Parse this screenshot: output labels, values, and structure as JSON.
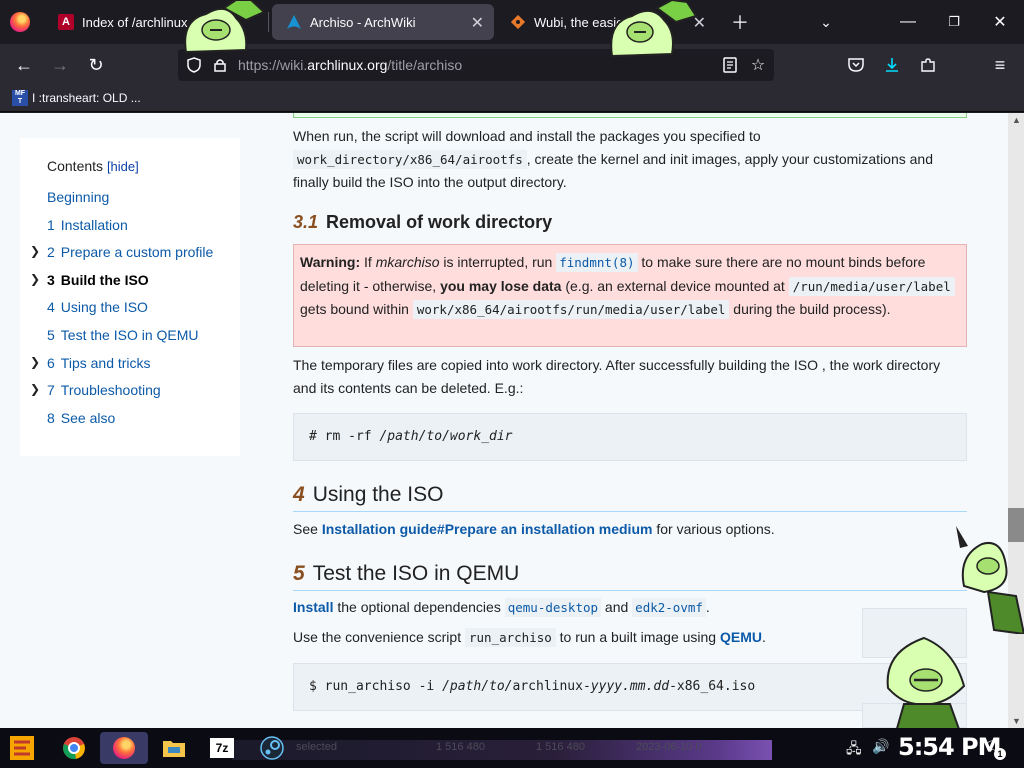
{
  "browser": {
    "tabs": [
      {
        "title": "Index of /archlinux",
        "icon": "arizona-a-icon"
      },
      {
        "title": "Archiso - ArchWiki",
        "icon": "arch-logo-icon",
        "active": true
      },
      {
        "title": "Wubi, the easiest",
        "icon": "wubi-icon"
      }
    ],
    "url_prefix": "https://wiki.",
    "url_domain": "archlinux.org",
    "url_path": "/title/archiso",
    "bookmark": "I :transheart: OLD ...",
    "bookmark_icon_text": "MF T"
  },
  "toc": {
    "title": "Contents",
    "hide_label": "[hide]",
    "items": [
      {
        "num": "",
        "label": "Beginning"
      },
      {
        "num": "1",
        "label": "Installation"
      },
      {
        "num": "2",
        "label": "Prepare a custom profile",
        "expandable": true
      },
      {
        "num": "3",
        "label": "Build the ISO",
        "expandable": true,
        "current": true
      },
      {
        "num": "4",
        "label": "Using the ISO"
      },
      {
        "num": "5",
        "label": "Test the ISO in QEMU"
      },
      {
        "num": "6",
        "label": "Tips and tricks",
        "expandable": true
      },
      {
        "num": "7",
        "label": "Troubleshooting",
        "expandable": true
      },
      {
        "num": "8",
        "label": "See also"
      }
    ]
  },
  "article": {
    "p1_a": "When run, the script will download and install the packages you specified to",
    "p1_code": "work_directory/x86_64/airootfs",
    "p1_b": ", create the kernel and init images, apply your customizations and finally build the ISO into the output directory.",
    "h31_num": "3.1",
    "h31_title": "Removal of work directory",
    "warn_label": "Warning:",
    "warn_a": " If ",
    "warn_mk": "mkarchiso",
    "warn_b": " is interrupted, run ",
    "warn_link": "findmnt(8)",
    "warn_c": " to make sure there are no mount binds before deleting it - otherwise, ",
    "warn_bold": "you may lose data",
    "warn_d": " (e.g. an external device mounted at ",
    "warn_code1": "/run/media/user/label",
    "warn_e": " gets bound within ",
    "warn_code2": "work/x86_64/airootfs/run/media/user/label",
    "warn_f": " during the build process).",
    "p2": "The temporary files are copied into work directory. After successfully building the ISO , the work directory and its contents can be deleted. E.g.:",
    "pre1_prefix": "# rm -rf ",
    "pre1_italic": "/path/to/work_dir",
    "h2a_num": "4",
    "h2a_title": "Using the ISO",
    "p3_a": "See ",
    "p3_link": "Installation guide#Prepare an installation medium",
    "p3_b": " for various options.",
    "h2b_num": "5",
    "h2b_title": "Test the ISO in QEMU",
    "p4_link1": "Install",
    "p4_a": " the optional dependencies ",
    "p4_link2": "qemu-desktop",
    "p4_b": " and ",
    "p4_link3": "edk2-ovmf",
    "p4_c": ".",
    "p5_a": "Use the convenience script ",
    "p5_code": "run_archiso",
    "p5_b": " to run a built image using ",
    "p5_link": "QEMU",
    "p5_c": ".",
    "pre2_prefix": "$ run_archiso -i ",
    "pre2_italic": "/path/to/",
    "pre2_mid": "archlinux-",
    "pre2_italic2": "yyyy.mm.dd",
    "pre2_suffix": "-x86_64.iso"
  },
  "taskbar": {
    "ghost_selected": "selected",
    "ghost_size1": "1 516 480",
    "ghost_size2": "1 516 480",
    "ghost_date": "2023-06-10 0",
    "clock": "5:54 PM",
    "notif_count": "1",
    "sevenzip": "7z"
  },
  "colors": {
    "link": "#0c5aa8",
    "warning_bg": "#ffdddd",
    "heading_num": "#8a4f20",
    "tab_active": "#42414d"
  }
}
